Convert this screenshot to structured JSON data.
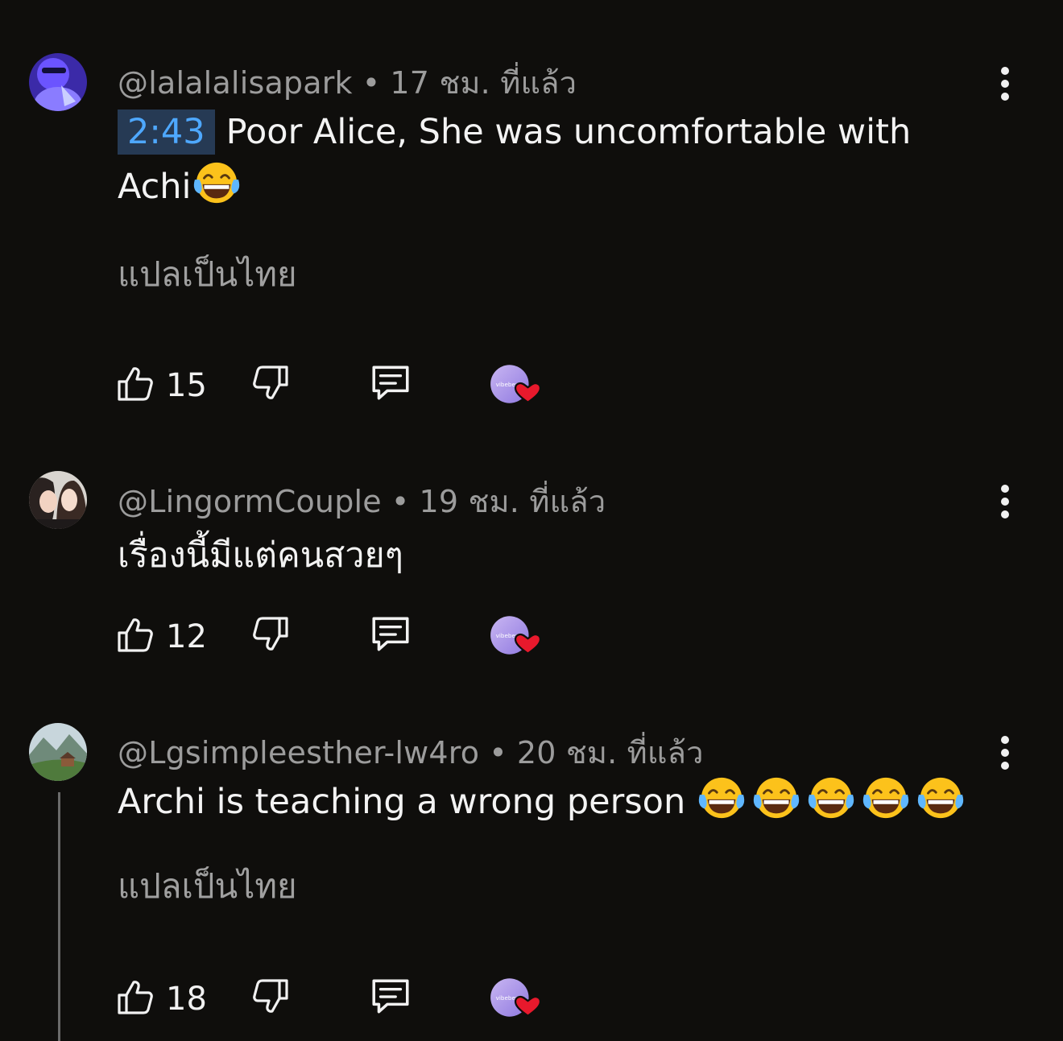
{
  "comments": [
    {
      "author": "@lalalalisapark",
      "time": "17 ชม. ที่แล้ว",
      "timestamp_link": "2:43",
      "text_line1": "Poor Alice, She was uncomfortable with",
      "text_line2": "Achi",
      "translate_label": "แปลเป็นไทย",
      "like_count": "15"
    },
    {
      "author": "@LingormCouple",
      "time": "19 ชม. ที่แล้ว",
      "text": "เรื่องนี้มีแต่คนสวยๆ",
      "like_count": "12"
    },
    {
      "author": "@Lgsimpleesther-lw4ro",
      "time": "20 ชม. ที่แล้ว",
      "text": "Archi is teaching a wrong person",
      "translate_label": "แปลเป็นไทย",
      "like_count": "18"
    }
  ],
  "separator": "•",
  "creator_heart_label": "vibeberry",
  "colors": {
    "background": "#0f0e0c",
    "meta_text": "#9c9c9c",
    "timestamp_bg": "#263a54",
    "timestamp_text": "#4ea8ff",
    "heart": "#e8192c"
  },
  "icons": [
    "kebab-menu-icon",
    "thumbs-up-icon",
    "thumbs-down-icon",
    "reply-icon",
    "creator-heart-icon",
    "laughing-emoji"
  ]
}
